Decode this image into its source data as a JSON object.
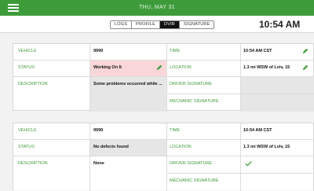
{
  "header": {
    "date": "THU, MAY  31",
    "accent": "#3e9b3a"
  },
  "tabs": [
    {
      "label": "LOGS",
      "active": false
    },
    {
      "label": "PROFILE",
      "active": false
    },
    {
      "label": "DVIR",
      "active": true
    },
    {
      "label": "SIGNATURE",
      "active": false
    }
  ],
  "clock": "10:54 AM",
  "reports": [
    {
      "vehicle_label": "VEHICLE",
      "vehicle": "9999",
      "time_label": "TIME",
      "time": "10:54 AM CST",
      "status_label": "STATUS",
      "status": "Working On It",
      "location_label": "LOCATION",
      "location": "1.3 mi WSW of Lviv, 15",
      "description_label": "DESCRIPTION",
      "description": "Some problems occurred while ...",
      "driver_signature_label": "DRIVER SIGNATURE",
      "mechanic_signature_label": "MECHANIC SIGNATURE",
      "status_color": "#f9d7d8"
    },
    {
      "vehicle_label": "VEHICLE",
      "vehicle": "9999",
      "time_label": "TIME",
      "time": "10:54 AM CST",
      "status_label": "STATUS",
      "status": "No defects found",
      "location_label": "LOCATION",
      "location": "1.3 mi WSW of Lviv, 15",
      "description_label": "DESCRIPTION",
      "description": "None",
      "driver_signature_label": "DRIVER SIGNATURE",
      "driver_signed": true,
      "mechanic_signature_label": "MECHANIC SIGNATURE",
      "status_color": "#e6e6e6"
    }
  ],
  "icons": {
    "menu": "menu-icon",
    "edit": "pencil-icon",
    "check": "check-icon"
  }
}
